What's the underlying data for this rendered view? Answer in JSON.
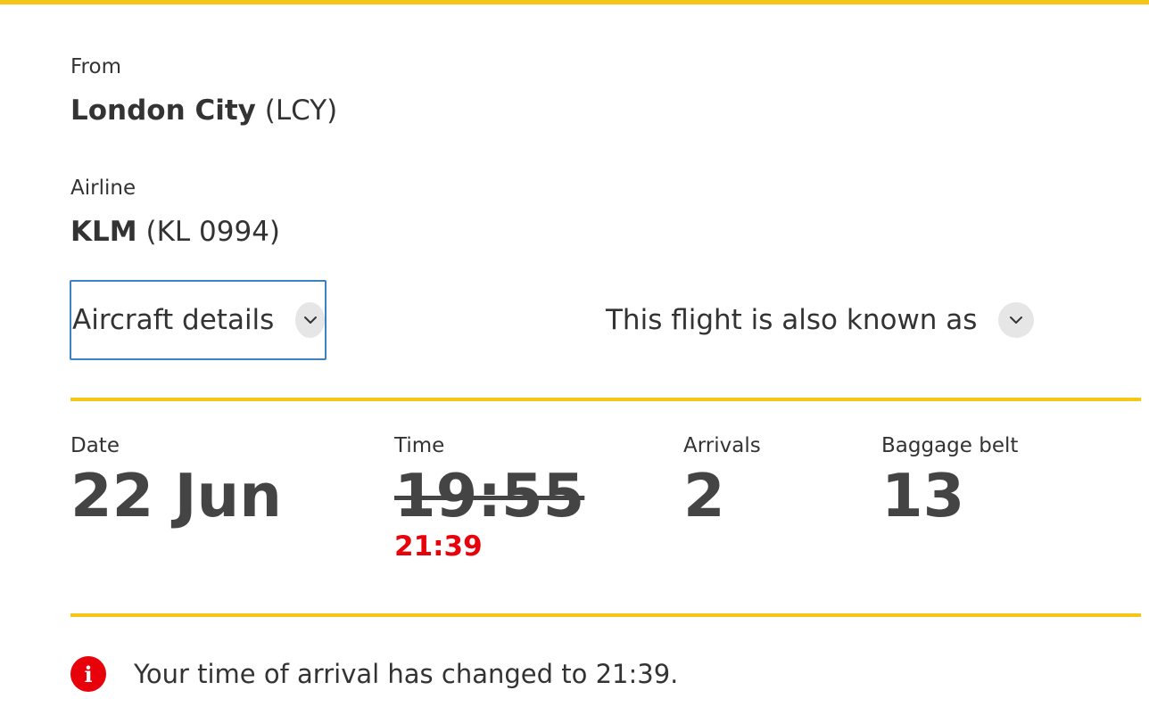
{
  "colors": {
    "accent": "#f5c518",
    "alert": "#e8000b",
    "focus_border": "#3b82c4",
    "text": "#333333"
  },
  "origin": {
    "label": "From",
    "name": "London City",
    "code": "(LCY)"
  },
  "airline": {
    "label": "Airline",
    "name": "KLM",
    "flight": "(KL 0994)"
  },
  "toggles": {
    "aircraft_details": "Aircraft details",
    "also_known_as": "This flight is also known as",
    "icon": "chevron-down-icon"
  },
  "details": {
    "date": {
      "label": "Date",
      "value": "22 Jun"
    },
    "time": {
      "label": "Time",
      "scheduled": "19:55",
      "actual": "21:39"
    },
    "arrivals": {
      "label": "Arrivals",
      "value": "2"
    },
    "baggage": {
      "label": "Baggage belt",
      "value": "13"
    }
  },
  "notice": {
    "icon": "info-icon",
    "icon_glyph": "i",
    "text": "Your time of arrival has changed to 21:39."
  }
}
